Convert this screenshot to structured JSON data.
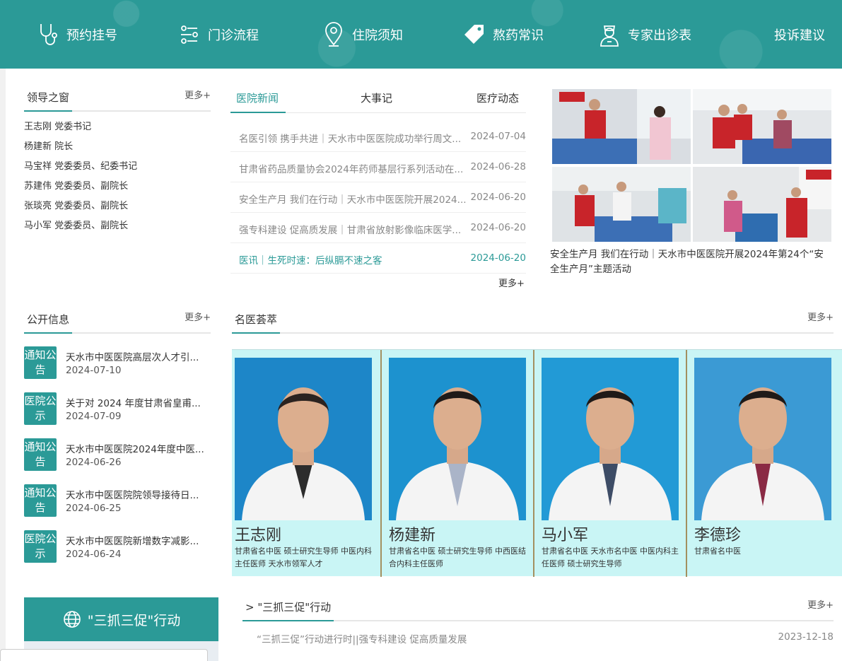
{
  "nav": {
    "items": [
      {
        "label": "预约挂号",
        "icon": "stethoscope-icon"
      },
      {
        "label": "门诊流程",
        "icon": "flow-icon"
      },
      {
        "label": "住院须知",
        "icon": "location-pin-icon"
      },
      {
        "label": "熬药常识",
        "icon": "tag-icon"
      },
      {
        "label": "专家出诊表",
        "icon": "doctor-icon"
      },
      {
        "label": "投诉建议",
        "icon": ""
      }
    ]
  },
  "leaders": {
    "title": "领导之窗",
    "more": "更多+",
    "items": [
      "王志刚 党委书记",
      "杨建新 院长",
      "马宝祥 党委委员、纪委书记",
      "苏建伟 党委委员、副院长",
      "张琰亮 党委委员、副院长",
      "马小军 党委委员、副院长"
    ]
  },
  "news": {
    "tabs": [
      "医院新闻",
      "大事记",
      "医疗动态"
    ],
    "items": [
      {
        "title": "名医引领 携手共进｜天水市中医医院成功举行周文...",
        "date": "2024-07-04"
      },
      {
        "title": "甘肃省药品质量协会2024年药师基层行系列活动在...",
        "date": "2024-06-28"
      },
      {
        "title": "安全生产月 我们在行动｜天水市中医医院开展2024...",
        "date": "2024-06-20"
      },
      {
        "title": "强专科建设 促高质发展｜甘肃省放射影像临床医学...",
        "date": "2024-06-20"
      },
      {
        "title": "医讯｜生死时速：后纵膈不速之客",
        "date": "2024-06-20"
      }
    ],
    "more": "更多+"
  },
  "photo_caption": "安全生产月 我们在行动｜天水市中医医院开展2024年第24个“安全生产月”主题活动",
  "public_info": {
    "title": "公开信息",
    "more": "更多+",
    "items": [
      {
        "badge": "通知公告",
        "title": "天水市中医医院高层次人才引...",
        "date": "2024-07-10"
      },
      {
        "badge": "医院公示",
        "title": "关于对 2024 年度甘肃省皇甫...",
        "date": "2024-07-09"
      },
      {
        "badge": "通知公告",
        "title": "天水市中医医院2024年度中医...",
        "date": "2024-06-26"
      },
      {
        "badge": "通知公告",
        "title": "天水市中医医院院领导接待日...",
        "date": "2024-06-25"
      },
      {
        "badge": "医院公示",
        "title": "天水市中医医院新增数字减影...",
        "date": "2024-06-24"
      }
    ]
  },
  "famous_doctors": {
    "title": "名医荟萃",
    "more": "更多+",
    "items": [
      {
        "name": "王志刚",
        "desc": "甘肃省名中医 硕士研究生导师 中医内科主任医师 天水市领军人才"
      },
      {
        "name": "杨建新",
        "desc": "甘肃省名中医 硕士研究生导师 中西医结合内科主任医师"
      },
      {
        "name": "马小军",
        "desc": "甘肃省名中医 天水市名中医 中医内科主任医师 硕士研究生导师"
      },
      {
        "name": "李德珍",
        "desc": "甘肃省名中医"
      }
    ]
  },
  "campaign": {
    "banner": "\"三抓三促\"行动",
    "title": "> \"三抓三促\"行动",
    "more": "更多+",
    "items": [
      {
        "title": "“三抓三促”行动进行时||强专科建设 促高质量发展",
        "date": "2023-12-18"
      }
    ]
  },
  "colors": {
    "accent": "#2b9a97",
    "doctor_bg": "#c9f5f5"
  }
}
